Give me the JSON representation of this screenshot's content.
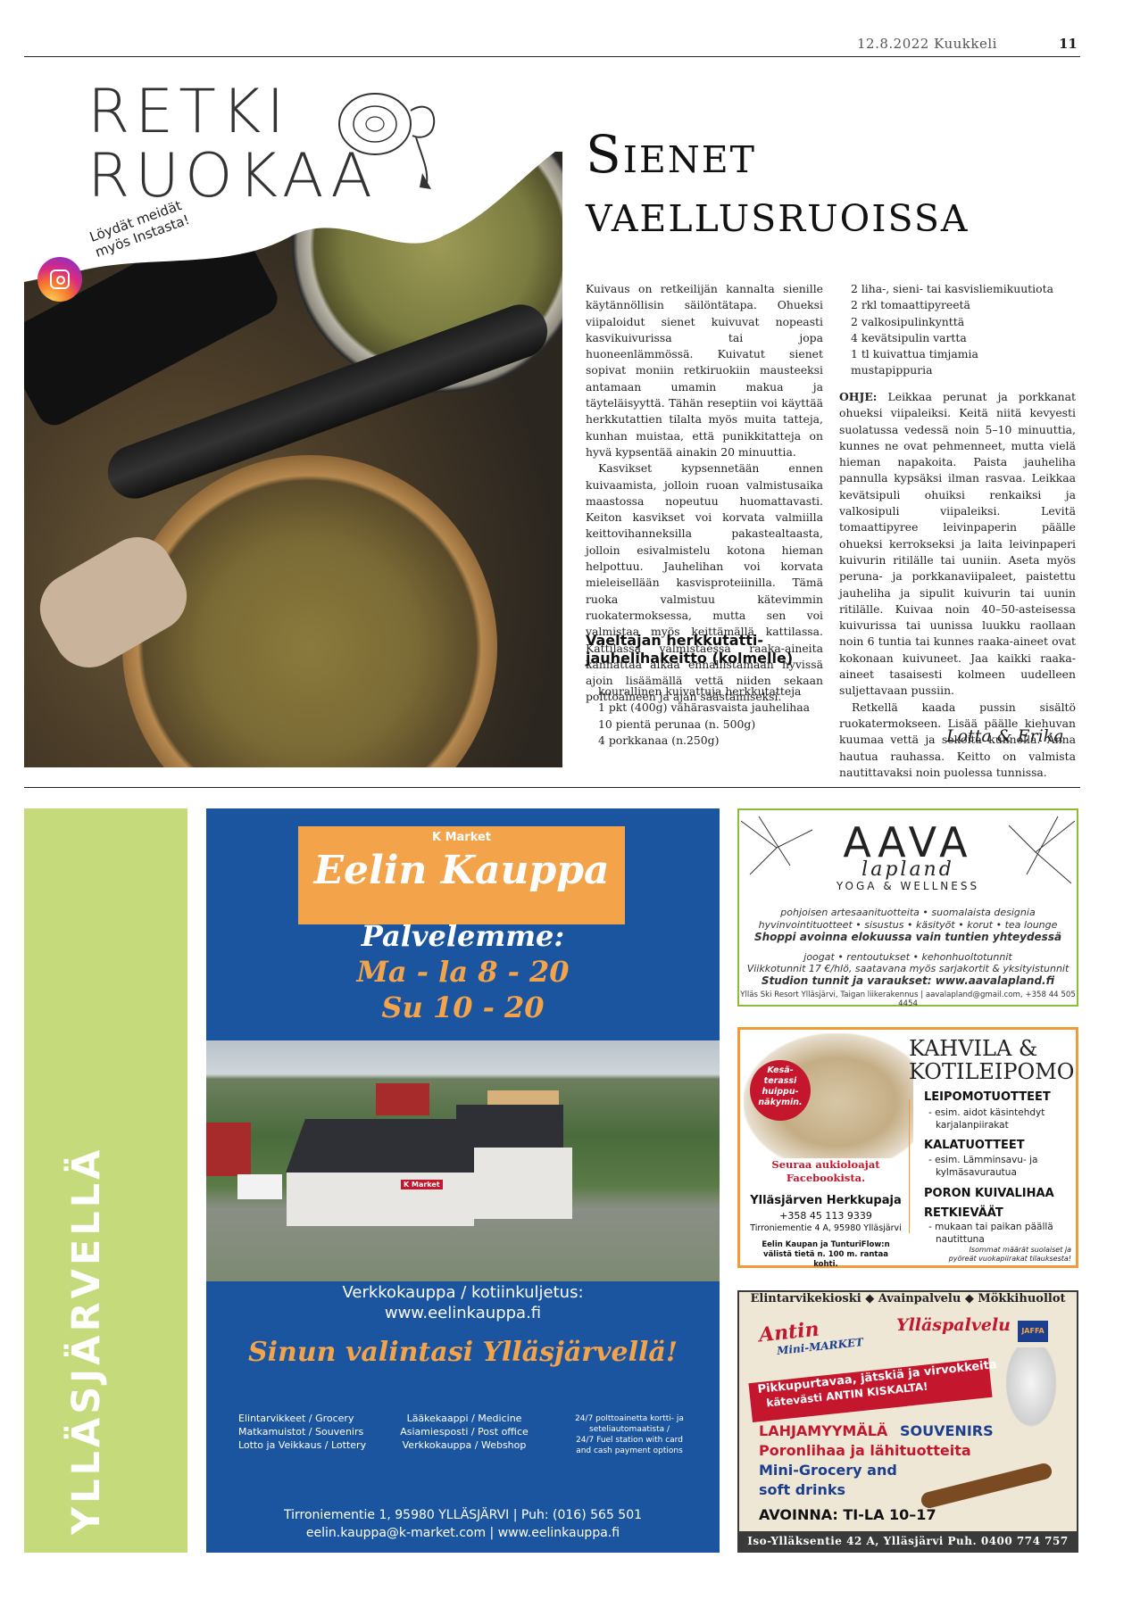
{
  "header": {
    "date": "12.8.2022 Kuukkeli",
    "page": "11"
  },
  "logo": {
    "line1": "RETKI",
    "line2": "RUOKAA",
    "insta1": "Löydät meidät",
    "insta2": "myös Instasta!"
  },
  "article": {
    "title1": "Sienet",
    "title2": "vaellusruoissa",
    "col1": [
      "Kuivaus on retkeilijän kannalta sienille käytännöllisin säilöntätapa. Ohueksi viipaloidut sienet kuivuvat nopeasti kasvikuivurissa tai jopa huoneenlämmössä. Kuivatut sienet sopivat moniin retkiruokiin mausteeksi antamaan umamin makua ja täyteläisyyttä. Tähän reseptiin voi käyttää herkkutattien tilalta myös muita tatteja, kunhan muistaa, että punikkitatteja on hyvä kypsentää ainakin 20 minuuttia.",
      "Kasvikset kypsennetään ennen kuivaamista, jolloin ruoan valmistusaika maastossa nopeutuu huomattavasti. Keiton kasvikset voi korvata valmiilla keittovihanneksilla pakastealtaasta, jolloin esivalmistelu kotona hieman helpottuu. Jauhelihan voi korvata mieleisellään kasvisproteiinilla. Tämä ruoka valmistuu kätevimmin ruokatermoksessa, mutta sen voi valmistaa myös keittämällä kattilassa. Kattilassa valmistaessa raaka-aineita kannattaa alkaa ennallistamaan hyvissä ajoin lisäämällä vettä niiden sekaan polttoaineen ja ajan säästämiseksi."
    ],
    "recipe_title": "Vaeltajan herkkutatti-jauhelihakeitto (kolmelle)",
    "ingredients1": [
      "kourallinen kuivattuja herkkutatteja",
      "1 pkt (400g) vähärasvaista jauhelihaa",
      "10 pientä perunaa (n. 500g)",
      "4 porkkanaa (n.250g)"
    ],
    "ingredients2": [
      "2 liha-, sieni- tai kasvisliemikuutiota",
      "2 rkl tomaattipyreetä",
      "2 valkosipulinkynttä",
      "4 kevätsipulin vartta",
      "1 tl kuivattua timjamia",
      "mustapippuria"
    ],
    "instructions_label": "OHJE:",
    "instructions": [
      "Leikkaa perunat ja porkkanat ohueksi viipaleiksi. Keitä niitä kevyesti suolatussa vedessä noin 5–10 minuuttia, kunnes ne ovat pehmenneet, mutta vielä hieman napakoita. Paista jauheliha pannulla kypsäksi ilman rasvaa. Leikkaa kevätsipuli ohuiksi renkaiksi ja valkosipuli viipaleiksi. Levitä tomaattipyree leivinpaperin päälle ohueksi kerrokseksi ja laita leivinpaperi kuivurin ritilälle tai uuniin. Aseta myös peruna- ja porkkanaviipaleet, paistettu jauheliha ja sipulit kuivurin tai uunin ritilälle. Kuivaa noin 40–50-asteisessa kuivurissa tai uunissa luukku raollaan noin 6 tuntia tai kunnes raaka-aineet ovat kokonaan kuivuneet. Jaa kaikki raaka-aineet tasaisesti kolmeen uudelleen suljettavaan pussiin.",
      "Retkellä kaada pussin sisältö ruokatermokseen. Lisää päälle kiehuvan kuumaa vettä ja sekoita kunnolla. Anna hautua rauhassa. Keitto on valmista nautittavaksi noin puolessa tunnissa."
    ],
    "signature": "Lotta & Erika"
  },
  "side": {
    "label": "YLLÄSJÄRVELLÄ"
  },
  "kmarket": {
    "brand": "K Market",
    "name": "Eelin Kauppa",
    "serve": "Palvelemme:",
    "hours1": "Ma - la 8 - 20",
    "hours2": "Su 10 - 20",
    "web1": "Verkkokauppa / kotiinkuljetus:",
    "web2": "www.eelinkauppa.fi",
    "slogan": "Sinun valintasi Ylläsjärvellä!",
    "list1": [
      "Elintarvikkeet / Grocery",
      "Matkamuistot / Souvenirs",
      "Lotto ja Veikkaus / Lottery"
    ],
    "list2": [
      "Lääkekaappi / Medicine",
      "Asiamiesposti / Post office",
      "Verkkokauppa / Webshop"
    ],
    "list3": [
      "24/7 polttoainetta kortti- ja",
      "seteliautomaatista /",
      "24/7 Fuel station with card",
      "and cash payment options"
    ],
    "addr1": "Tirroniementie 1, 95980 YLLÄSJÄRVI    |    Puh: (016) 565 501",
    "addr2": "eelin.kauppa@k-market.com    |    www.eelinkauppa.fi",
    "store_sign": "K Market"
  },
  "aava": {
    "logo": "AAVA",
    "sub": "lapland",
    "tag": "YOGA & WELLNESS",
    "l1": "pohjoisen artesaanituotteita • suomalaista designia",
    "l2": "hyvinvointituotteet • sisustus • käsityöt • korut • tea lounge",
    "l3": "Shoppi avoinna elokuussa vain tuntien yhteydessä",
    "l4": "joogat • rentoutukset • kehonhuoltotunnit",
    "l5": "Viikkotunnit 17 €/hlö, saatavana myös sarjakortit & yksityistunnit",
    "l6": "Studion tunnit ja varaukset: www.aavalapland.fi",
    "foot": "Ylläs Ski Resort Ylläsjärvi, Taigan liikerakennus | aavalapland@gmail.com, +358 44 505 4454"
  },
  "kahvila": {
    "title1": "KAHVILA &",
    "title2": "KOTILEIPOMO",
    "bubble": [
      "Kesä-",
      "terassi",
      "huippu-",
      "näkymin."
    ],
    "h1": "LEIPOMOTUOTTEET",
    "s1": [
      "- esim. aidot käsintehdyt",
      "karjalanpiirakat"
    ],
    "h2": "KALATUOTTEET",
    "s2": [
      "- esim. Lämminsavu- ja",
      "kylmäsavurautua"
    ],
    "h3": "PORON KUIVALIHAA",
    "h4": "RETKIEVÄÄT",
    "s4": [
      "- mukaan tai paikan päällä",
      "nautittuna"
    ],
    "note": [
      "Isommat määrät suolaiset ja",
      "pyöreät vuokapiirakat tilauksesta!"
    ],
    "fb": [
      "Seuraa aukioloajat",
      "Facebookista."
    ],
    "name": "Ylläsjärven Herkkupaja",
    "phone": "+358 45 113 9339",
    "addr": "Tirroniementie 4 A, 95980 Ylläsjärvi",
    "small": [
      "Eelin Kaupan ja TunturiFlow:n",
      "välistä tietä n. 100 m. rantaa kohti."
    ]
  },
  "antin": {
    "top": "Elintarvikekioski  ◆  Avainpalvelu  ◆  Mökkihuollot",
    "brand": "Antin",
    "mini": "Mini-MARKET",
    "ylla": "Ylläspalvelu",
    "jaffa": "JAFFA",
    "band1": "Pikkupurtavaa, jätskiä ja virvokkeita",
    "band2": "kätevästi ANTIN KISKALTA!",
    "lah": "LAHJAMYYMÄLÄ",
    "sou": "SOUVENIRS",
    "p1": "Poronlihaa ja lähituotteita",
    "p2": "Mini-Grocery and",
    "p3": "soft drinks",
    "open": "AVOINNA: TI-LA 10–17",
    "foot": "Iso-Ylläksentie 42 A, Ylläsjärvi Puh. 0400 774 757"
  }
}
